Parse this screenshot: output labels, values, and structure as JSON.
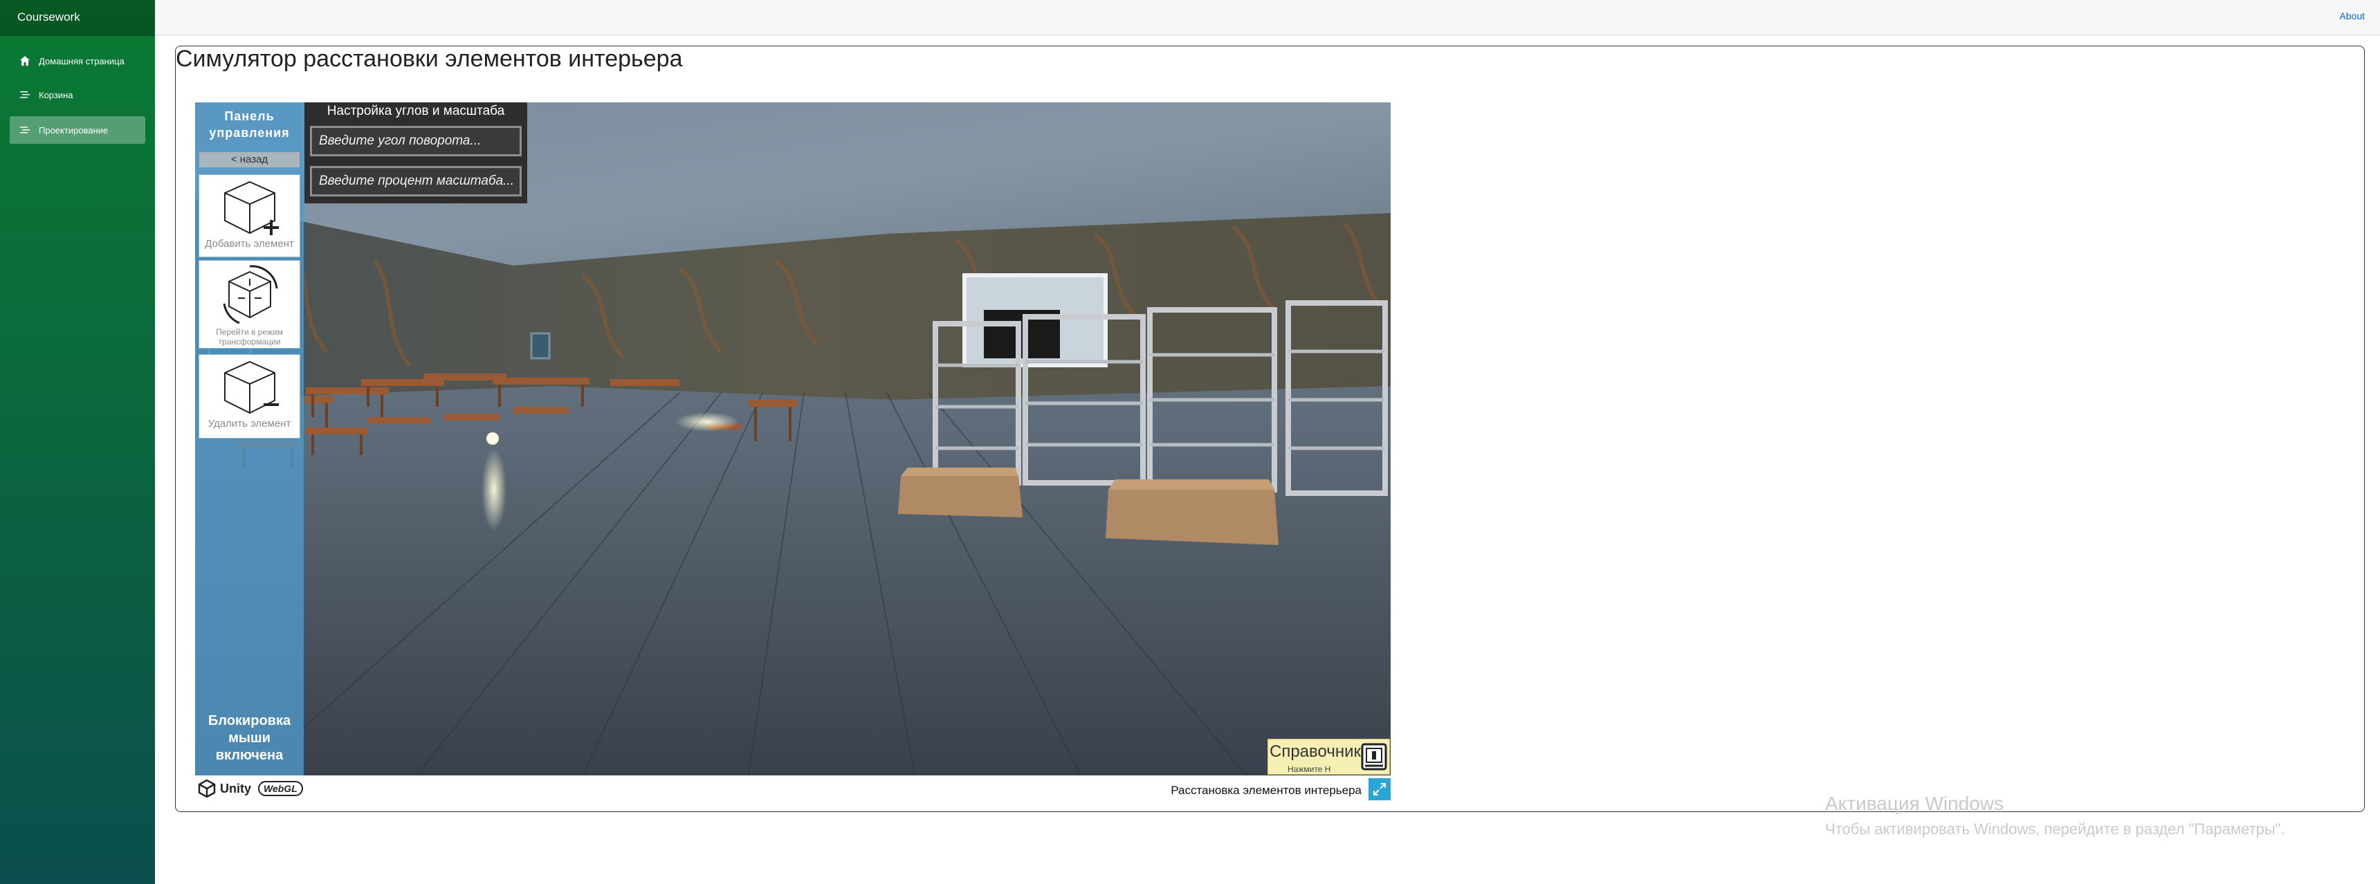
{
  "app": {
    "brand": "Coursework"
  },
  "sidebar": {
    "items": [
      {
        "label": "Домашняя страница",
        "icon": "home-icon",
        "active": false
      },
      {
        "label": "Корзина",
        "icon": "list-icon",
        "active": false
      },
      {
        "label": "Проектирование",
        "icon": "list-icon",
        "active": true
      }
    ]
  },
  "topbar": {
    "about_label": "About"
  },
  "page": {
    "title": "Симулятор расстановки элементов интерьера"
  },
  "unity": {
    "control_panel": {
      "title_line1": "Панель",
      "title_line2": "управления",
      "back_label": "< назад",
      "tools": [
        {
          "label": "Добавить элемент",
          "icon": "cube-plus-icon"
        },
        {
          "label_line1": "Перейти в режим",
          "label_line2": "трансформации",
          "icon": "cube-transform-icon"
        },
        {
          "label": "Удалить элемент",
          "icon": "cube-minus-icon"
        }
      ],
      "mouse_lock_line1": "Блокировка",
      "mouse_lock_line2": "мыши включена"
    },
    "angles_panel": {
      "title": "Настройка углов и масштаба",
      "rotation_placeholder": "Введите угол поворота...",
      "scale_placeholder": "Введите процент масштаба..."
    },
    "help": {
      "title": "Справочник",
      "hint": "Нажмите H"
    },
    "footer": {
      "unity_label": "Unity",
      "webgl_label": "WebGL",
      "title": "Расстановка элементов интерьера"
    }
  },
  "watermark": {
    "line1": "Активация Windows",
    "line2": "Чтобы активировать Windows, перейдите в раздел \"Параметры\"."
  },
  "colors": {
    "sidebar_top": "#0a7a32",
    "sidebar_bottom": "#0a4e4d",
    "panel_blue": "#509bcd",
    "help_yellow": "#f5efb4",
    "fullscreen_blue": "#2ba6d6"
  }
}
